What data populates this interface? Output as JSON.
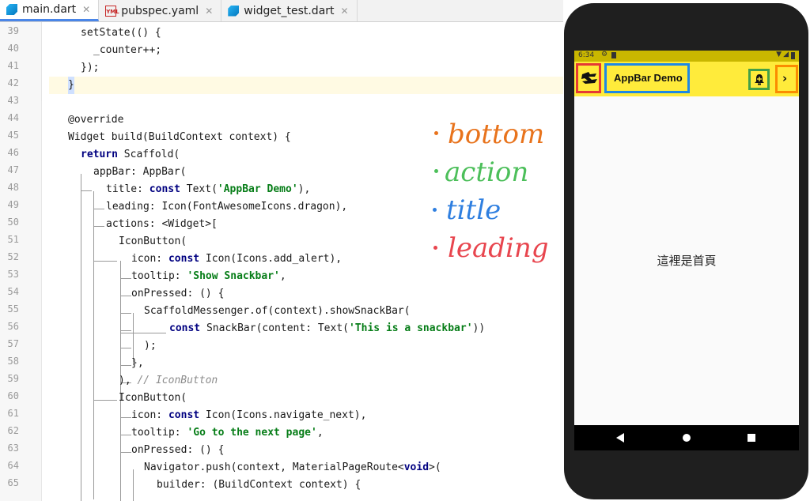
{
  "tabs": [
    {
      "label": "main.dart",
      "icon": "dart-file-icon",
      "active": true
    },
    {
      "label": "pubspec.yaml",
      "icon": "yaml-file-icon",
      "active": false
    },
    {
      "label": "widget_test.dart",
      "icon": "dart-file-icon",
      "active": false
    }
  ],
  "tab_close_glyph": "✕",
  "code": {
    "line_numbers": [
      "39",
      "40",
      "41",
      "42",
      "43",
      "44",
      "45",
      "46",
      "47",
      "48",
      "49",
      "50",
      "51",
      "52",
      "53",
      "54",
      "55",
      "56",
      "57",
      "58",
      "59",
      "60",
      "61",
      "62",
      "63",
      "64",
      "65"
    ],
    "lines": [
      "setState(() {",
      "_counter++;",
      "});",
      "}",
      "",
      "@override",
      "Widget build(BuildContext context) {",
      "return Scaffold(",
      "appBar: AppBar(",
      "title: const Text('AppBar Demo'),",
      "leading: Icon(FontAwesomeIcons.dragon),",
      "actions: <Widget>[",
      "IconButton(",
      "icon: const Icon(Icons.add_alert),",
      "tooltip: 'Show Snackbar',",
      "onPressed: () {",
      "ScaffoldMessenger.of(context).showSnackBar(",
      "const SnackBar(content: Text('This is a snackbar'))",
      ");",
      "},",
      "), // IconButton",
      "IconButton(",
      "icon: const Icon(Icons.navigate_next),",
      "tooltip: 'Go to the next page',",
      "onPressed: () {",
      "Navigator.push(context, MaterialPageRoute<void>(",
      "builder: (BuildContext context) {"
    ]
  },
  "annotations": [
    {
      "text": "bottom",
      "color": "#e8731c"
    },
    {
      "text": "action",
      "color": "#4cbf5a"
    },
    {
      "text": "title",
      "color": "#2f7fe0"
    },
    {
      "text": "leading",
      "color": "#e8454e"
    }
  ],
  "phone": {
    "status_time": "6:34",
    "appbar_title": "AppBar Demo",
    "body_text": "這裡是首頁",
    "leading_icon": "dragon-icon",
    "action_icons": [
      "add-alert-icon",
      "navigate-next-icon"
    ],
    "appbar_color": "#ffeb3b",
    "highlight_colors": {
      "leading": "#e53935",
      "title": "#1e88e5",
      "action": "#43a047",
      "bottom": "#fb8c00"
    }
  }
}
